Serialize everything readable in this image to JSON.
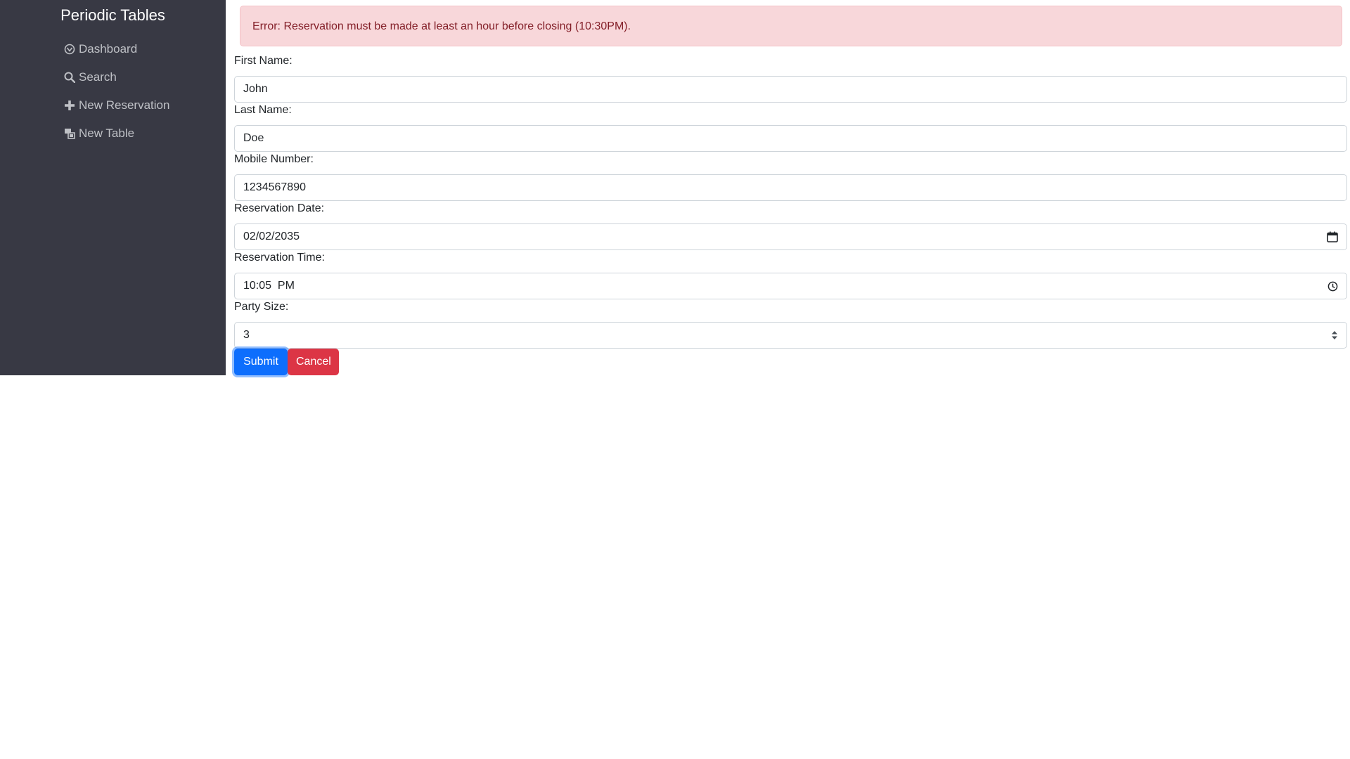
{
  "sidebar": {
    "title": "Periodic Tables",
    "items": [
      {
        "label": "Dashboard",
        "icon": "dashboard-icon"
      },
      {
        "label": "Search",
        "icon": "search-icon"
      },
      {
        "label": "New Reservation",
        "icon": "plus-icon"
      },
      {
        "label": "New Table",
        "icon": "table-icon"
      }
    ]
  },
  "alert": {
    "message": "Error: Reservation must be made at least an hour before closing (10:30PM)."
  },
  "form": {
    "first_name": {
      "label": "First Name:",
      "value": "John"
    },
    "last_name": {
      "label": "Last Name:",
      "value": "Doe"
    },
    "mobile_number": {
      "label": "Mobile Number:",
      "value": "1234567890"
    },
    "reservation_date": {
      "label": "Reservation Date:",
      "value": "02/02/2035",
      "icon": "calendar-icon"
    },
    "reservation_time": {
      "label": "Reservation Time:",
      "value": "10:05  PM",
      "icon": "clock-icon"
    },
    "party_size": {
      "label": "Party Size:",
      "value": "3",
      "icon": "spinner-arrows-icon"
    },
    "submit_label": "Submit",
    "cancel_label": "Cancel"
  },
  "colors": {
    "sidebar_bg": "#383944",
    "alert_bg": "#f8d7da",
    "alert_text": "#842029",
    "submit_bg": "#0d6efd",
    "cancel_bg": "#dc3545"
  }
}
